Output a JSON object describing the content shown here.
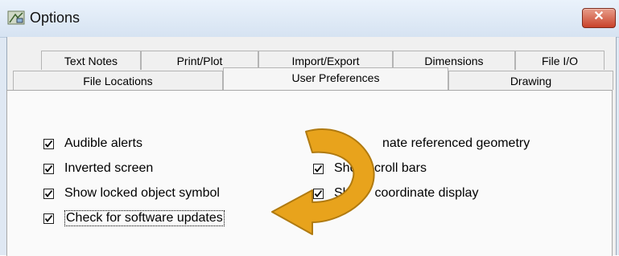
{
  "window": {
    "title": "Options",
    "close_label": "✕",
    "app_icon": "drafting-app-icon"
  },
  "tabs_row1": [
    {
      "label": "Text Notes"
    },
    {
      "label": "Print/Plot"
    },
    {
      "label": "Import/Export"
    },
    {
      "label": "Dimensions"
    },
    {
      "label": "File I/O"
    }
  ],
  "tabs_row2": [
    {
      "label": "File Locations"
    },
    {
      "label": "User Preferences",
      "selected": true
    },
    {
      "label": "Drawing"
    }
  ],
  "options_left": [
    {
      "label": "Audible alerts",
      "checked": true
    },
    {
      "label": "Inverted screen",
      "checked": true
    },
    {
      "label": "Show locked object symbol",
      "checked": true
    },
    {
      "label": "Check for software updates",
      "checked": true,
      "focused": true
    }
  ],
  "options_right": [
    {
      "label": "Animate referenced geometry",
      "visible_text": "nate referenced geometry",
      "checked": true
    },
    {
      "label": "Show scroll bars",
      "visible_text": "Show",
      "visible_tail": "croll bars",
      "checked": true
    },
    {
      "label": "Show coordinate display",
      "visible_text": "Sho",
      "visible_tail": "coordinate display",
      "checked": true
    }
  ],
  "annotation": {
    "type": "curved-arrow",
    "color": "#e8a31c",
    "outline": "#b07a10"
  }
}
